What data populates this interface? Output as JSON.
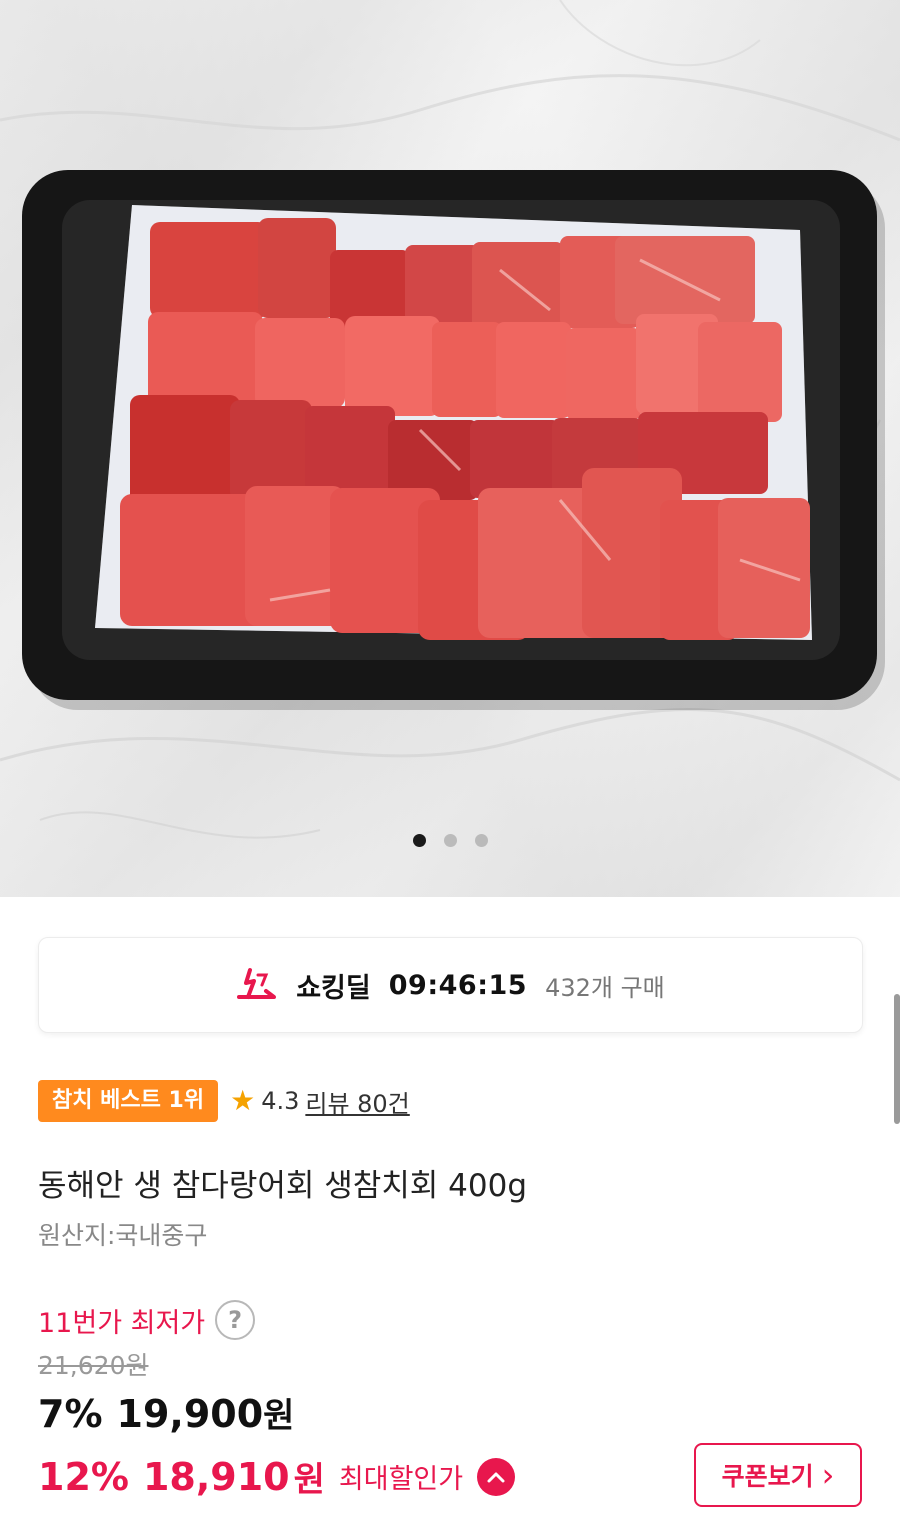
{
  "gallery": {
    "image_alt": "",
    "total_images": 3,
    "active_index": 1
  },
  "deal": {
    "title": "쇼킹딜",
    "timer": "09:46:15",
    "purchase_count": "432개 구매",
    "logo_icon": "shocking-deal-logo-icon",
    "accent": "#e8174d"
  },
  "badge": {
    "label": "참치 베스트 1위",
    "color": "#ff8a1e"
  },
  "rating": {
    "score": "4.3",
    "review_label": "리뷰 80건",
    "star_icon": "star-icon"
  },
  "product": {
    "title": "동해안 생 참다랑어회 생참치회 400g",
    "origin": "원산지:국내중구"
  },
  "pricing": {
    "lowest_label": "11번가 최저가",
    "help_symbol": "?",
    "original_price": "21,620원",
    "sale_percent": "7%",
    "sale_price": "19,900",
    "sale_currency": "원",
    "max_percent": "12%",
    "max_price": "18,910",
    "max_currency": "원",
    "max_label": "최대할인가",
    "accent": "#e8174d"
  },
  "coupon": {
    "label": "쿠폰보기",
    "chevron": "›"
  }
}
